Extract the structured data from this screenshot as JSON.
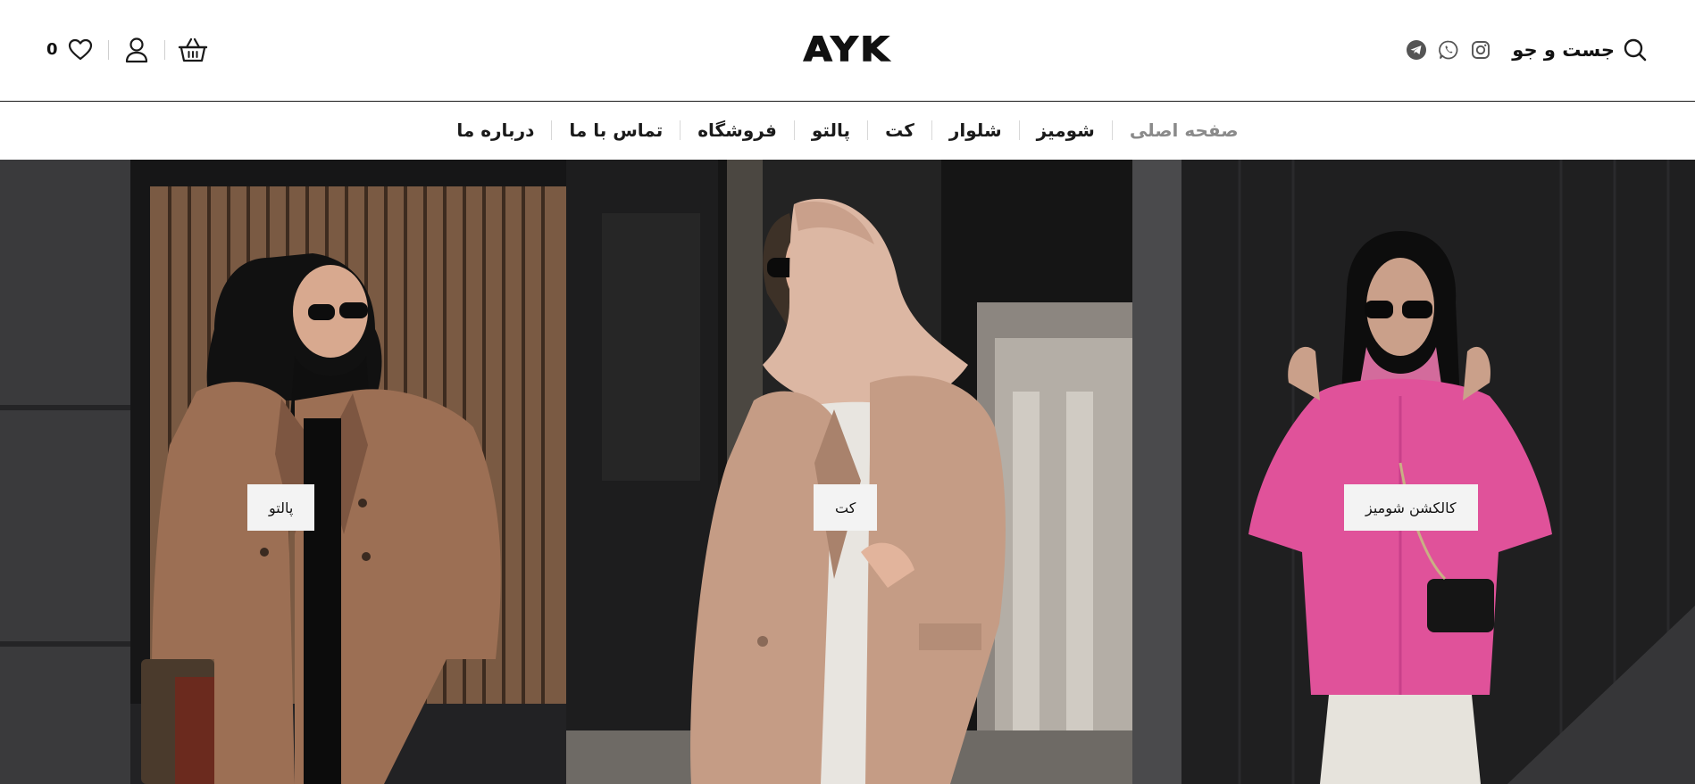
{
  "brand": {
    "logo_text": "AYK"
  },
  "header": {
    "wishlist_count": "0",
    "search_label": "جست و جو",
    "icons": {
      "wishlist": "heart-icon",
      "account": "user-icon",
      "cart": "basket-icon",
      "search": "search-icon",
      "instagram": "instagram-icon",
      "whatsapp": "whatsapp-icon",
      "telegram": "telegram-icon"
    }
  },
  "nav": {
    "items": [
      {
        "label": "صفحه اصلی",
        "active": true
      },
      {
        "label": "شومیز",
        "active": false
      },
      {
        "label": "شلوار",
        "active": false
      },
      {
        "label": "کت",
        "active": false
      },
      {
        "label": "پالتو",
        "active": false
      },
      {
        "label": "فروشگاه",
        "active": false
      },
      {
        "label": "تماس با ما",
        "active": false
      },
      {
        "label": "درباره ما",
        "active": false
      }
    ]
  },
  "hero": {
    "panels": [
      {
        "button_label": "پالتو"
      },
      {
        "button_label": "کت"
      },
      {
        "button_label": "کالکشن شومیز"
      }
    ]
  },
  "colors": {
    "text": "#111111",
    "active_nav": "#8a8a8a",
    "button_bg": "#f3f3f3",
    "coat_brown": "#9c6f54",
    "blazer_beige": "#c59c85",
    "shirt_pink": "#e0529a"
  }
}
